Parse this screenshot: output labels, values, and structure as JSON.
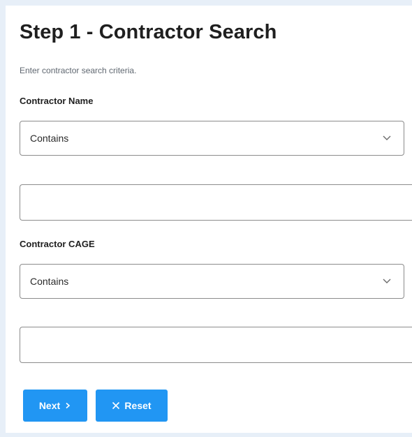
{
  "page": {
    "title": "Step 1 - Contractor Search",
    "subtitle": "Enter contractor search criteria."
  },
  "fields": {
    "contractor_name": {
      "label": "Contractor Name",
      "operator": "Contains",
      "value": "",
      "placeholder": ""
    },
    "contractor_cage": {
      "label": "Contractor CAGE",
      "operator": "Contains",
      "value": "",
      "placeholder": ""
    }
  },
  "buttons": {
    "next_label": "Next",
    "next_icon": "chevron-right-icon",
    "reset_label": "Reset",
    "reset_icon": "close-icon"
  },
  "colors": {
    "accent": "#2196f3",
    "background": "#e7eff8",
    "panel": "#ffffff",
    "border": "#8c8c8c"
  }
}
